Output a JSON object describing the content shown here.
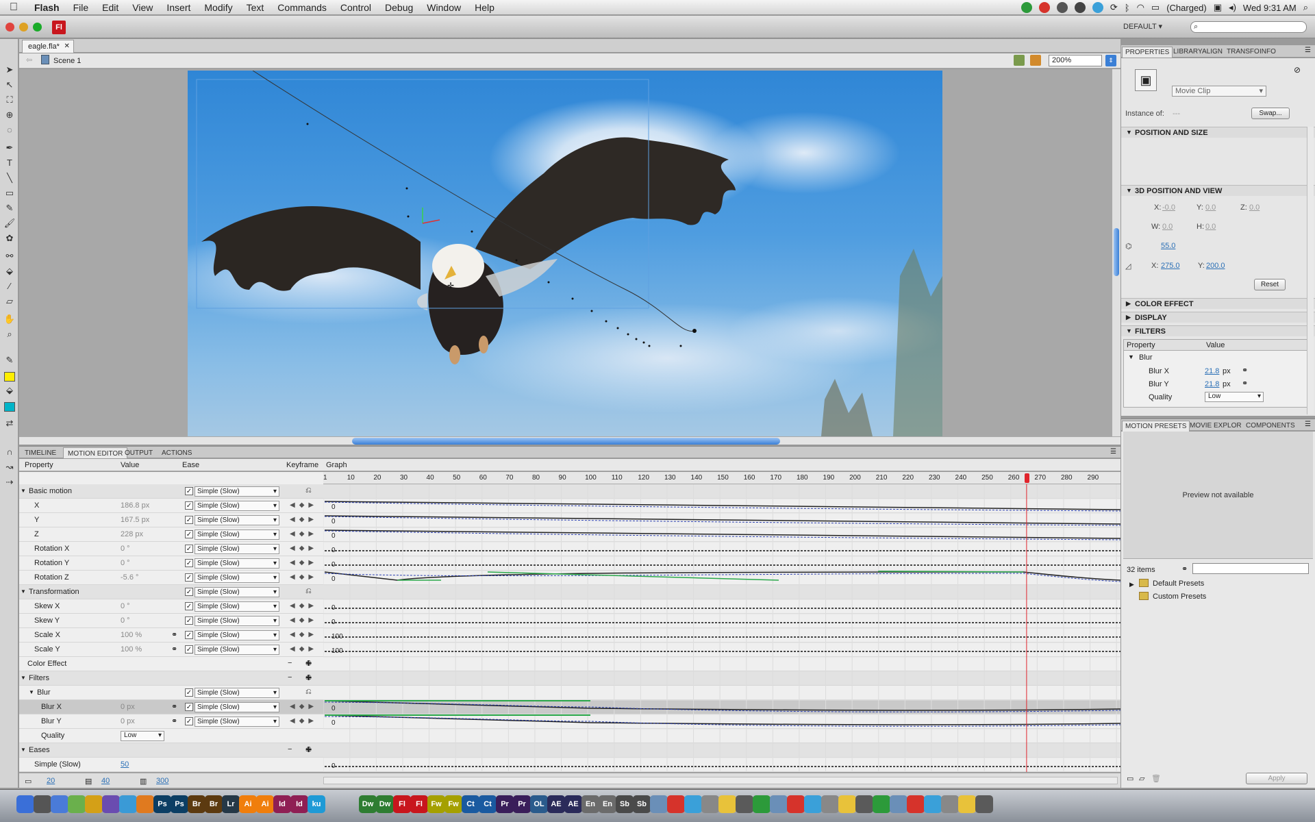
{
  "menubar": {
    "app": "Flash",
    "items": [
      "File",
      "Edit",
      "View",
      "Insert",
      "Modify",
      "Text",
      "Commands",
      "Control",
      "Debug",
      "Window",
      "Help"
    ],
    "battery": "(Charged)",
    "clock": "Wed 9:31 AM"
  },
  "titlebar": {
    "app_badge": "Fl",
    "workspace": "DEFAULT ▾"
  },
  "document": {
    "tab": "eagle.fla*",
    "scene": "Scene 1",
    "zoom": "200%"
  },
  "bottom_tabs": [
    "TIMELINE",
    "MOTION EDITOR",
    "OUTPUT",
    "ACTIONS"
  ],
  "motion_editor": {
    "headers": {
      "property": "Property",
      "value": "Value",
      "ease": "Ease",
      "keyframe": "Keyframe",
      "graph": "Graph"
    },
    "frame_ticks": [
      "1",
      "10",
      "20",
      "30",
      "40",
      "50",
      "60",
      "70",
      "80",
      "90",
      "100",
      "110",
      "120",
      "130",
      "140",
      "150",
      "160",
      "170",
      "180",
      "190",
      "200",
      "210",
      "220",
      "230",
      "240",
      "250",
      "260",
      "270",
      "280",
      "290"
    ],
    "playhead_frame": 266,
    "ease_label": "Simple (Slow)",
    "rows": [
      {
        "name": "Basic motion",
        "kind": "section"
      },
      {
        "name": "X",
        "value": "186.8 px",
        "kind": "prop",
        "graph_label": "0"
      },
      {
        "name": "Y",
        "value": "167.5 px",
        "kind": "prop",
        "graph_label": "0"
      },
      {
        "name": "Z",
        "value": "228 px",
        "kind": "prop",
        "graph_label": "0"
      },
      {
        "name": "Rotation X",
        "value": "0 °",
        "kind": "prop",
        "graph_label": "0"
      },
      {
        "name": "Rotation Y",
        "value": "0 °",
        "kind": "prop",
        "graph_label": "0"
      },
      {
        "name": "Rotation Z",
        "value": "-5.6 °",
        "kind": "prop",
        "graph_label": "0"
      },
      {
        "name": "Transformation",
        "kind": "section"
      },
      {
        "name": "Skew X",
        "value": "0 °",
        "kind": "prop",
        "graph_label": "0"
      },
      {
        "name": "Skew Y",
        "value": "0 °",
        "kind": "prop",
        "graph_label": "0"
      },
      {
        "name": "Scale X",
        "value": "100 %",
        "kind": "prop",
        "graph_label": "100"
      },
      {
        "name": "Scale Y",
        "value": "100 %",
        "kind": "prop",
        "graph_label": "100"
      },
      {
        "name": "Color Effect",
        "kind": "group"
      },
      {
        "name": "Filters",
        "kind": "section"
      },
      {
        "name": "Blur",
        "kind": "subsection"
      },
      {
        "name": "Blur X",
        "value": "0 px",
        "kind": "prop",
        "graph_label": "0"
      },
      {
        "name": "Blur Y",
        "value": "0 px",
        "kind": "prop",
        "graph_label": "0"
      },
      {
        "name": "Quality",
        "value": "Low",
        "kind": "quality"
      },
      {
        "name": "Eases",
        "kind": "section"
      },
      {
        "name": "Simple (Slow)",
        "value": "50",
        "kind": "ease",
        "graph_label": "0"
      }
    ],
    "footer": {
      "graph_size": "20",
      "expanded_size": "40",
      "frames": "300"
    }
  },
  "properties": {
    "tabs": [
      "PROPERTIES",
      "LIBRARY",
      "ALIGN",
      "TRANSFO",
      "INFO"
    ],
    "instance_type": "Movie Clip",
    "instance_of_label": "Instance of:",
    "instance_of_value": "---",
    "swap": "Swap...",
    "sections": {
      "position": "POSITION AND SIZE",
      "pos3d": "3D POSITION AND VIEW",
      "color": "COLOR EFFECT",
      "display": "DISPLAY",
      "filters": "FILTERS"
    },
    "pos3d": {
      "x": "-0.0",
      "y": "0.0",
      "z": "0.0",
      "w": "0.0",
      "h": "0.0",
      "perspective": "55.0",
      "vp_x": "275.0",
      "vp_y": "200.0",
      "reset": "Reset"
    },
    "filter_table": {
      "headers": [
        "Property",
        "Value"
      ],
      "filter_name": "Blur",
      "rows": [
        {
          "name": "Blur X",
          "value": "21.8",
          "unit": "px"
        },
        {
          "name": "Blur Y",
          "value": "21.8",
          "unit": "px"
        },
        {
          "name": "Quality",
          "value": "Low"
        }
      ]
    }
  },
  "presets": {
    "tabs": [
      "MOTION PRESETS",
      "MOVIE EXPLOR",
      "COMPONENTS"
    ],
    "preview": "Preview not available",
    "count": "32 items",
    "folders": [
      "Default Presets",
      "Custom Presets"
    ],
    "apply": "Apply"
  },
  "dock": [
    "Ps",
    "Ps",
    "Br",
    "Br",
    "Lr",
    "Ai",
    "Ai",
    "Id",
    "Id",
    "ku",
    "Dw",
    "Dw",
    "Fl",
    "Fl",
    "Fw",
    "Fw",
    "Ct",
    "Ct",
    "Pr",
    "Pr",
    "OL",
    "AE",
    "AE",
    "En",
    "En",
    "Sb",
    "Sb"
  ],
  "colors": {
    "playhead": "#e0252d",
    "curve_blue": "#2a3fb0",
    "curve_green": "#2aa84a",
    "accent": "#3a7fd6"
  }
}
